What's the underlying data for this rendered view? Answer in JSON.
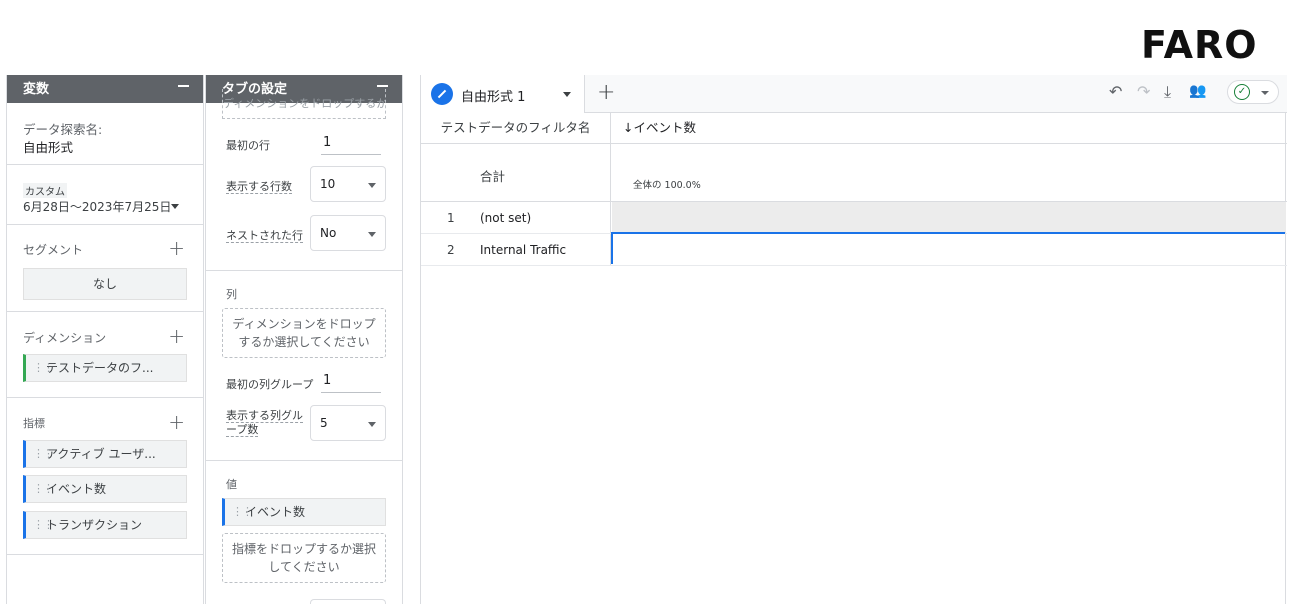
{
  "brand": "FARO",
  "variables_panel": {
    "header": "変数",
    "exploration_name_label": "データ探索名:",
    "exploration_name": "自由形式",
    "date_tag": "カスタム",
    "date_range": "6月28日～2023年7月25日",
    "segments_label": "セグメント",
    "segments_empty": "なし",
    "dimensions_label": "ディメンション",
    "dimensions": [
      "テストデータのフ..."
    ],
    "metrics_label": "指標",
    "metrics": [
      "アクティブ ユーザ...",
      "イベント数",
      "トランザクション"
    ]
  },
  "tab_settings_panel": {
    "header": "タブの設定",
    "top_cut_text": "ディメンションをドロップするか選択してください",
    "start_row_label": "最初の行",
    "start_row_value": "1",
    "show_rows_label": "表示する行数",
    "show_rows_value": "10",
    "nested_rows_label": "ネストされた行",
    "nested_rows_value": "No",
    "columns_label": "列",
    "columns_drop": "ディメンションをドロップするか選択してください",
    "first_col_group_label": "最初の列グループ",
    "first_col_group_value": "1",
    "show_col_groups_label": "表示する列グループ数",
    "show_col_groups_value": "5",
    "values_label": "値",
    "values": [
      "イベント数"
    ],
    "values_drop": "指標をドロップするか選択してください"
  },
  "canvas": {
    "tab_label": "自由形式 1",
    "dimension_header": "テストデータのフィルタ名",
    "metric_header": "↓イベント数",
    "total_label": "合計",
    "total_pct": "全体の 100.0%",
    "rows": [
      {
        "index": "1",
        "name": "(not set)",
        "share": 1.0
      },
      {
        "index": "2",
        "name": "Internal Traffic",
        "share": 0.003
      }
    ],
    "colors": {
      "accent": "#1a73e8",
      "bar_fill": "#ececec",
      "ok": "#188038"
    }
  }
}
